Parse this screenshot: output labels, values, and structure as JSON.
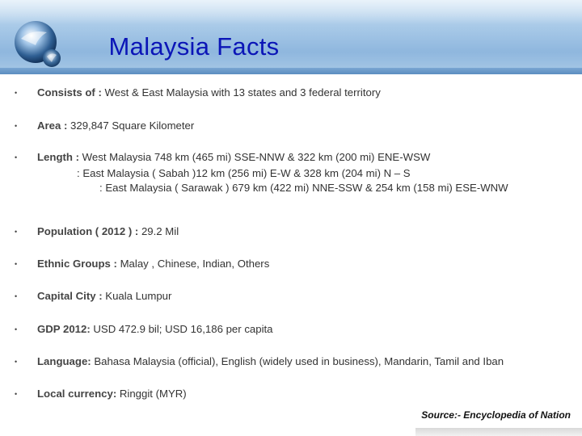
{
  "slide": {
    "title": "Malaysia Facts",
    "items": [
      {
        "label": "Consists of :",
        "value": " West & East Malaysia with 13 states and 3 federal territory"
      },
      {
        "label": "Area :",
        "value": " 329,847 Square Kilometer"
      },
      {
        "label": "Length :",
        "value": "  West Malaysia 748 km (465 mi) SSE-NNW & 322 km (200 mi) ENE-WSW",
        "line2": ": East Malaysia ( Sabah )12 km (256 mi) E-W & 328 km (204 mi) N – S",
        "line3": ": East Malaysia ( Sarawak ) 679 km (422 mi) NNE-SSW & 254 km (158 mi) ESE-WNW"
      },
      {
        "label": "Population ( 2012 ) :",
        "value": " 29.2 Mil"
      },
      {
        "label": "Ethnic Groups :",
        "value": " Malay , Chinese, Indian, Others"
      },
      {
        "label": "Capital City :",
        "value": " Kuala Lumpur"
      },
      {
        "label": "GDP 2012:",
        "value": "  USD 472.9 bil; USD 16,186 per capita"
      },
      {
        "label": "Language:",
        "value": " Bahasa Malaysia (official), English (widely used in business), Mandarin, Tamil and Iban"
      },
      {
        "label": "Local currency:",
        "value": " Ringgit (MYR)"
      }
    ],
    "bullet": "•",
    "source": "Source:- Encyclopedia of Nation"
  },
  "colors": {
    "title": "#0b15b7",
    "header": "#8fb7de"
  },
  "icons": {
    "logo": "globe-logo-icon"
  }
}
